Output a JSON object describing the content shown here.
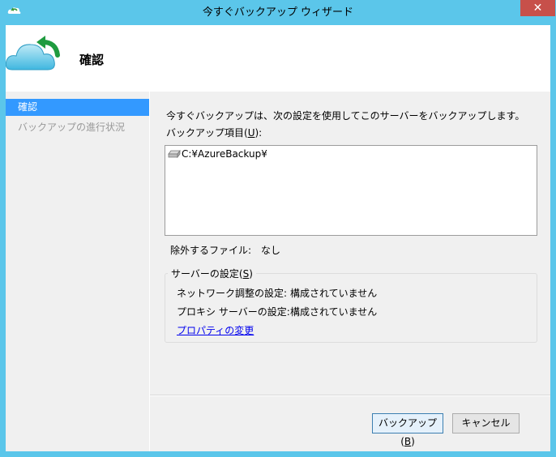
{
  "window": {
    "title": "今すぐバックアップ ウィザード",
    "close_label": "✕"
  },
  "banner": {
    "title": "確認",
    "icon": "cloud-backup-icon"
  },
  "nav": {
    "items": [
      {
        "label": "確認",
        "selected": true
      },
      {
        "label": "バックアップの進行状況",
        "selected": false
      }
    ]
  },
  "main": {
    "description": "今すぐバックアップは、次の設定を使用してこのサーバーをバックアップします。",
    "items_label_prefix": "バックアップ項目(",
    "items_label_key": "U",
    "items_label_suffix": "):",
    "backup_items": [
      "C:¥AzureBackup¥"
    ],
    "excluded_label": "除外するファイル:",
    "excluded_value": "なし",
    "server_settings": {
      "title_prefix": "サーバーの設定(",
      "title_key": "S",
      "title_suffix": ")",
      "network_label": "ネットワーク調整の設定:",
      "network_value": "構成されていません",
      "proxy_label": "プロキシ サーバーの設定:",
      "proxy_value": "構成されていません",
      "change_link": "プロパティの変更"
    }
  },
  "buttons": {
    "backup_prefix": "バックアップ(",
    "backup_key": "B",
    "backup_suffix": ")",
    "cancel": "キャンセル"
  },
  "colors": {
    "titlebar": "#5bc6ea",
    "selection": "#3399ff",
    "close": "#c7504a",
    "link": "#0000ee"
  }
}
